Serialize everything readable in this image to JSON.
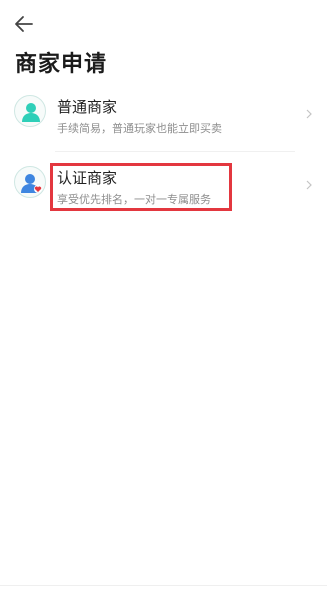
{
  "header": {
    "back_icon": "arrow-left-icon"
  },
  "page": {
    "title": "商家申请"
  },
  "options": [
    {
      "title": "普通商家",
      "subtitle": "手续简易，普通玩家也能立即买卖",
      "icon": "person-avatar-icon",
      "icon_color": "#2ecfb8"
    },
    {
      "title": "认证商家",
      "subtitle": "享受优先排名，一对一专属服务",
      "icon": "verified-person-avatar-icon",
      "icon_color": "#3f86e0",
      "badge_color": "#e3373f"
    }
  ],
  "accent": {
    "highlight": "#e3373f"
  }
}
